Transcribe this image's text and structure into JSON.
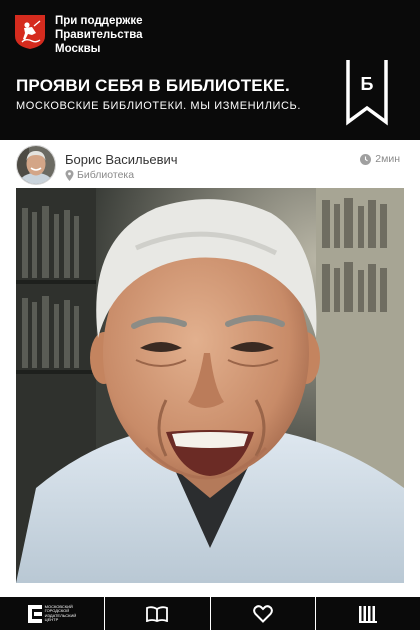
{
  "header": {
    "gov_lines": [
      "При поддержке",
      "Правительства",
      "Москвы"
    ],
    "title": "ПРОЯВИ СЕБЯ В БИБЛИОТЕКЕ.",
    "subtitle": "МОСКОВСКИЕ БИБЛИОТЕКИ. МЫ ИЗМЕНИЛИСЬ.",
    "bookmark_letter": "Б",
    "emblem_icon": "moscow-coat-of-arms-icon",
    "bookmark_icon": "bookmark-icon"
  },
  "author": {
    "name": "Борис Васильевич",
    "location": "Библиотека",
    "time": "2мин",
    "avatar_icon": "avatar",
    "location_icon": "pin-icon",
    "time_icon": "clock-icon"
  },
  "photo": {
    "icon": "portrait-photo"
  },
  "bottom_bar": {
    "logo_lines": [
      "МОСКОВСКИЙ",
      "ГОРОДСКОЙ",
      "ИЗДАТЕЛЬСКИЙ",
      "ЦЕНТР"
    ],
    "items": [
      {
        "icon": "publisher-logo-icon"
      },
      {
        "icon": "book-icon"
      },
      {
        "icon": "heart-icon"
      },
      {
        "icon": "library-icon"
      }
    ]
  },
  "colors": {
    "background": "#0a0a0a",
    "emblem_red": "#d52b1e",
    "text_muted": "#8a8a8a"
  }
}
